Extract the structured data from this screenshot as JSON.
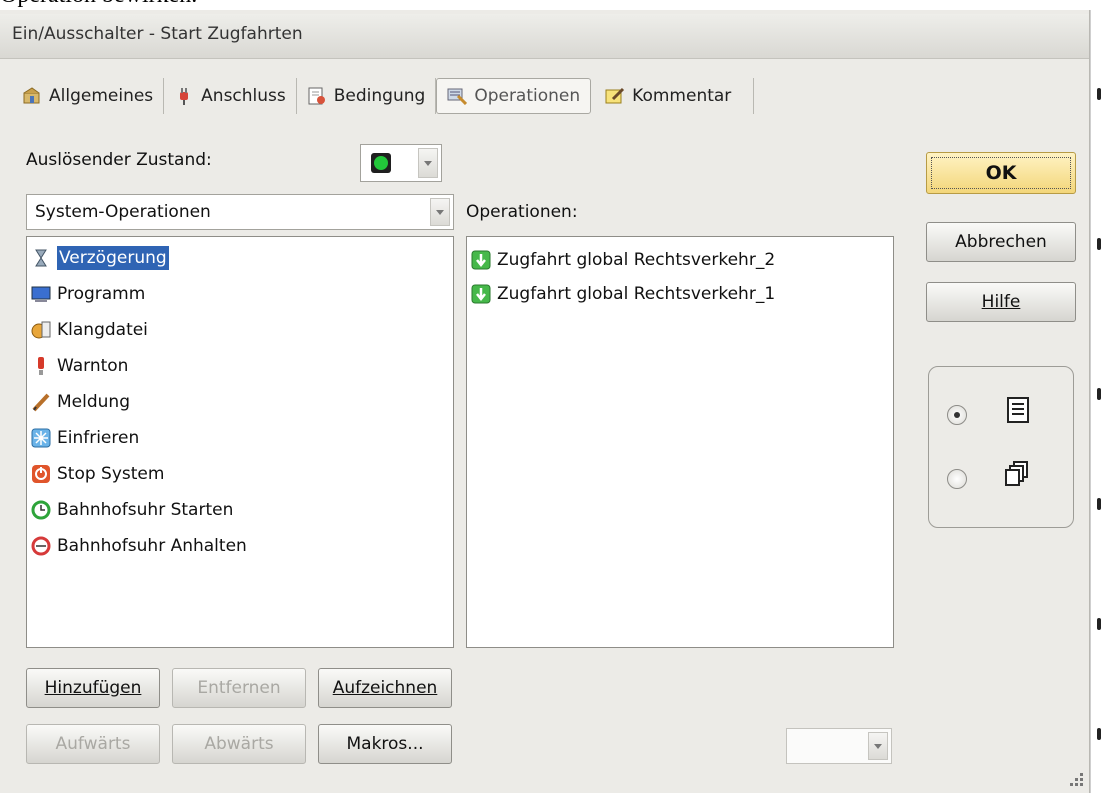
{
  "page_text": "Operation bewirken.",
  "window": {
    "title": "Ein/Ausschalter - Start Zugfahrten"
  },
  "tabs": [
    {
      "label": "Allgemeines",
      "icon": "general-icon"
    },
    {
      "label": "Anschluss",
      "icon": "plug-icon"
    },
    {
      "label": "Bedingung",
      "icon": "condition-icon"
    },
    {
      "label": "Operationen",
      "icon": "operations-icon",
      "active": true
    },
    {
      "label": "Kommentar",
      "icon": "comment-icon"
    }
  ],
  "trigger": {
    "label": "Auslösender Zustand:",
    "state_color": "#22c73a"
  },
  "category": {
    "value": "System-Operationen"
  },
  "system_ops": [
    {
      "label": "Verzögerung",
      "icon": "hourglass-icon",
      "selected": true
    },
    {
      "label": "Programm",
      "icon": "program-icon"
    },
    {
      "label": "Klangdatei",
      "icon": "sound-file-icon"
    },
    {
      "label": "Warnton",
      "icon": "warning-tone-icon"
    },
    {
      "label": "Meldung",
      "icon": "message-icon"
    },
    {
      "label": "Einfrieren",
      "icon": "freeze-icon"
    },
    {
      "label": "Stop System",
      "icon": "stop-system-icon"
    },
    {
      "label": "Bahnhofsuhr Starten",
      "icon": "clock-start-icon"
    },
    {
      "label": "Bahnhofsuhr Anhalten",
      "icon": "clock-stop-icon"
    }
  ],
  "operations": {
    "label": "Operationen:",
    "items": [
      {
        "label": "Zugfahrt global Rechtsverkehr_2",
        "icon": "green-down-arrow-icon"
      },
      {
        "label": "Zugfahrt global Rechtsverkehr_1",
        "icon": "green-down-arrow-icon"
      }
    ]
  },
  "buttons": {
    "ok": "OK",
    "cancel": "Abbrechen",
    "help": "Hilfe",
    "add": "Hinzufügen",
    "remove": "Entfernen",
    "record": "Aufzeichnen",
    "up": "Aufwärts",
    "down": "Abwärts",
    "macros": "Makros..."
  },
  "view_mode": {
    "selected": "list",
    "options": [
      "list",
      "copy"
    ]
  }
}
